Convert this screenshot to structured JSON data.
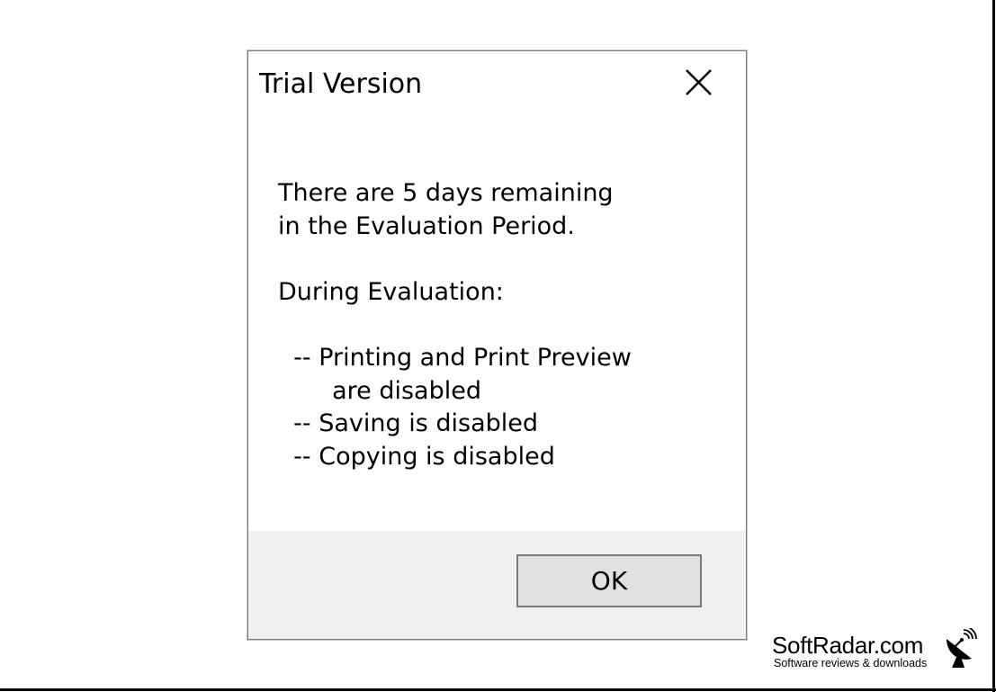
{
  "dialog": {
    "title": "Trial Version",
    "message_lines": [
      "There are 5 days remaining",
      "in the Evaluation Period.",
      "",
      "During Evaluation:",
      "",
      "  -- Printing and Print Preview",
      "       are disabled",
      "  -- Saving is disabled",
      "  -- Copying is disabled"
    ],
    "ok_label": "OK",
    "close_icon": "close-icon"
  },
  "watermark": {
    "name": "SoftRadar.com",
    "tagline": "Software reviews & downloads",
    "icon": "satellite-dish-icon"
  },
  "colors": {
    "dialog_border": "#7a7a7a",
    "footer_bg": "#f0f0f0",
    "button_bg": "#e1e1e1"
  }
}
